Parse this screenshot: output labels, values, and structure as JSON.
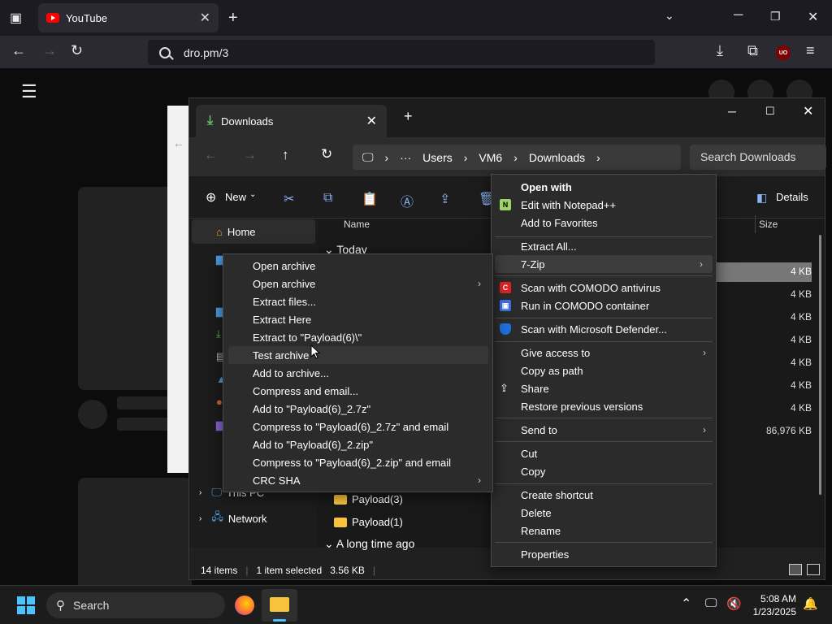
{
  "browser": {
    "tab_title": "YouTube",
    "url": "dro.pm/3",
    "ublock_badge": "UO"
  },
  "explorer": {
    "tab_title": "Downloads",
    "breadcrumbs": [
      "Users",
      "VM6",
      "Downloads"
    ],
    "search_placeholder": "Search Downloads",
    "toolbar": {
      "new_label": "New",
      "details_label": "Details"
    },
    "nav": {
      "home": "Home",
      "this_pc": "This PC",
      "network": "Network"
    },
    "columns": {
      "name": "Name",
      "size": "Size"
    },
    "groups": {
      "today": "Today",
      "long_ago": "A long time ago"
    },
    "visible_files": [
      {
        "name": "Payload(3)"
      },
      {
        "name": "Payload(1)"
      }
    ],
    "sizes": [
      "4 KB",
      "4 KB",
      "4 KB",
      "4 KB",
      "4 KB",
      "4 KB",
      "4 KB",
      "86,976 KB"
    ],
    "status": {
      "items": "14 items",
      "selected": "1 item selected",
      "size": "3.56 KB"
    }
  },
  "context_menu": {
    "items": [
      {
        "label": "Open with",
        "bold": true
      },
      {
        "label": "Edit with Notepad++"
      },
      {
        "label": "Add to Favorites"
      },
      {
        "label": "Extract All..."
      },
      {
        "label": "7-Zip",
        "submenu": true
      },
      {
        "label": "Scan with COMODO antivirus"
      },
      {
        "label": "Run in COMODO container"
      },
      {
        "label": "Scan with Microsoft Defender..."
      },
      {
        "label": "Give access to",
        "submenu": true
      },
      {
        "label": "Copy as path"
      },
      {
        "label": "Share"
      },
      {
        "label": "Restore previous versions"
      },
      {
        "label": "Send to",
        "submenu": true
      },
      {
        "label": "Cut"
      },
      {
        "label": "Copy"
      },
      {
        "label": "Create shortcut"
      },
      {
        "label": "Delete"
      },
      {
        "label": "Rename"
      },
      {
        "label": "Properties"
      }
    ]
  },
  "sevenzip_menu": {
    "items": [
      {
        "label": "Open archive"
      },
      {
        "label": "Open archive",
        "submenu": true
      },
      {
        "label": "Extract files..."
      },
      {
        "label": "Extract Here"
      },
      {
        "label": "Extract to \"Payload(6)\\\""
      },
      {
        "label": "Test archive"
      },
      {
        "label": "Add to archive..."
      },
      {
        "label": "Compress and email..."
      },
      {
        "label": "Add to \"Payload(6)_2.7z\""
      },
      {
        "label": "Compress to \"Payload(6)_2.7z\" and email"
      },
      {
        "label": "Add to \"Payload(6)_2.zip\""
      },
      {
        "label": "Compress to \"Payload(6)_2.zip\" and email"
      },
      {
        "label": "CRC SHA",
        "submenu": true
      }
    ]
  },
  "taskbar": {
    "search_label": "Search",
    "time": "5:08 AM",
    "date": "1/23/2025"
  }
}
